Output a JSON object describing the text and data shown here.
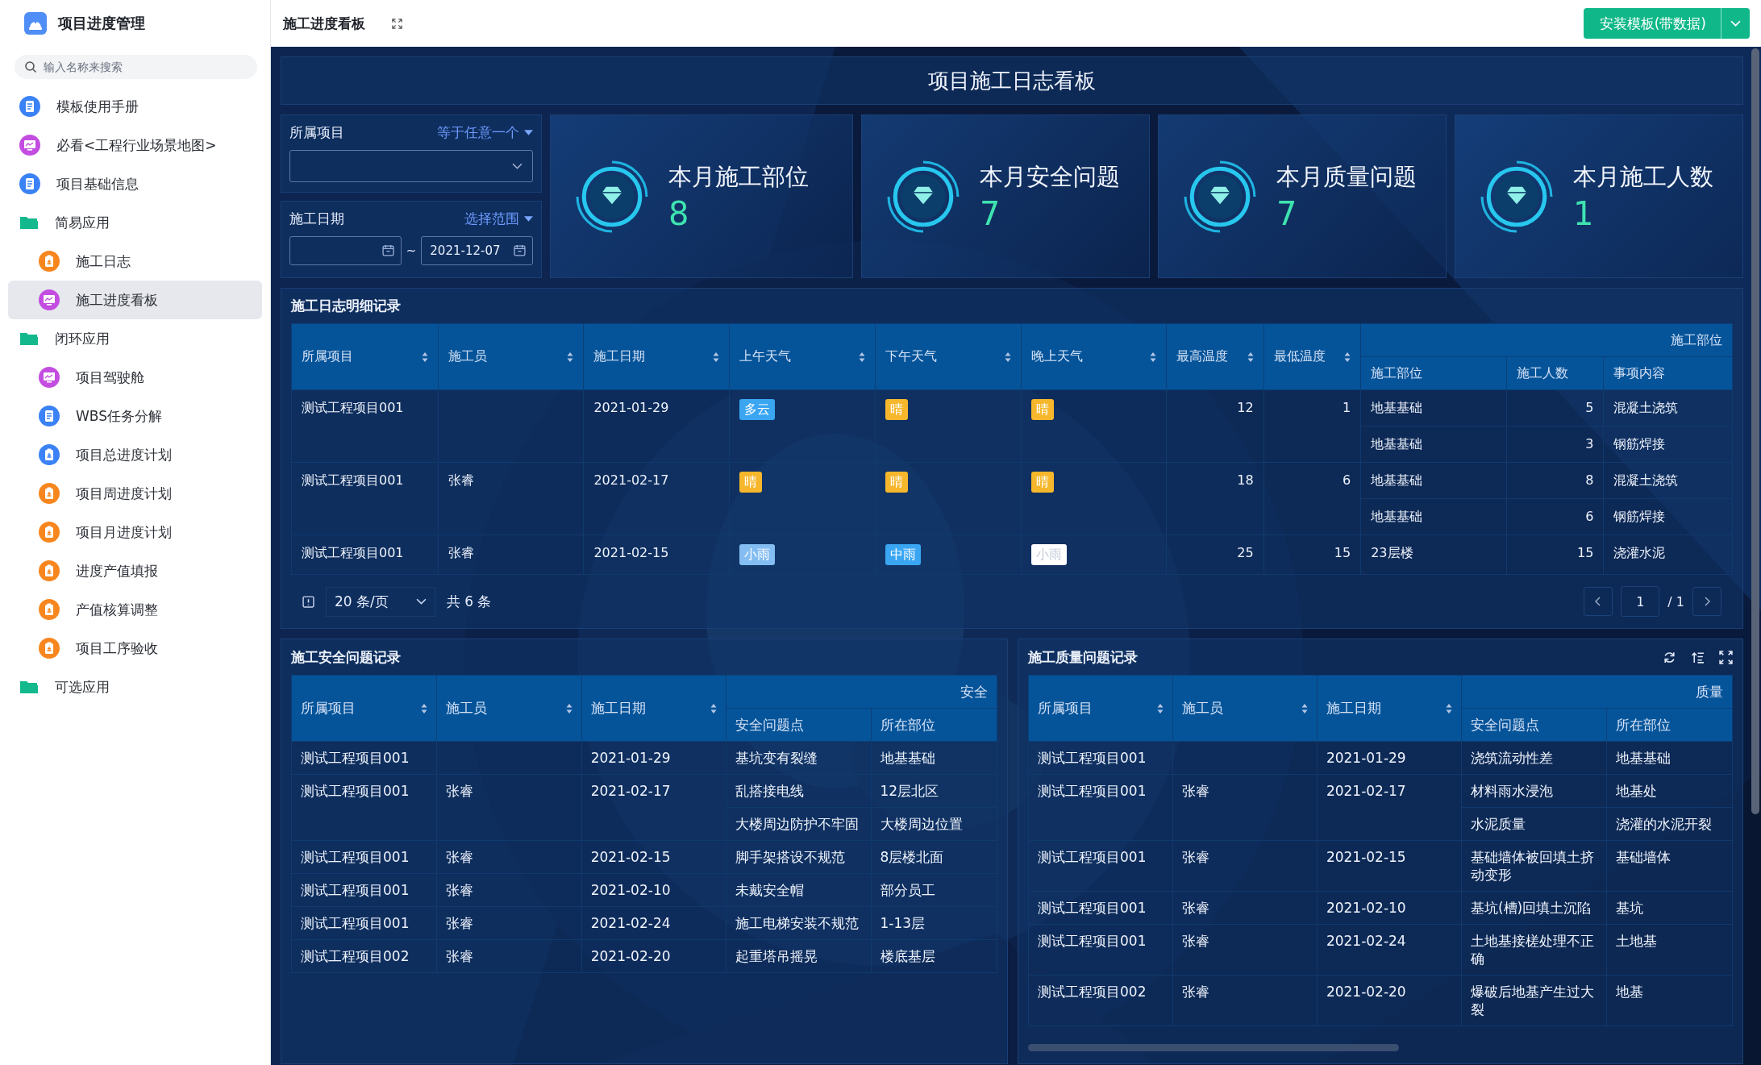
{
  "app": {
    "title": "项目进度管理"
  },
  "sidebar": {
    "search": {
      "placeholder": "输入名称来搜索"
    },
    "items": [
      {
        "label": "模板使用手册",
        "kind": "doc",
        "color": "#3b82f6",
        "selected": false
      },
      {
        "label": "必看<工程行业场景地图>",
        "kind": "screen",
        "color": "#c34de0",
        "selected": false
      },
      {
        "label": "项目基础信息",
        "kind": "doc",
        "color": "#3b82f6",
        "selected": false
      },
      {
        "label": "简易应用",
        "kind": "folder",
        "color": "#13b98c",
        "selected": false,
        "children": [
          {
            "label": "施工日志",
            "kind": "form",
            "color": "#f7861e",
            "selected": false
          },
          {
            "label": "施工进度看板",
            "kind": "screen",
            "color": "#c34de0",
            "selected": true
          }
        ]
      },
      {
        "label": "闭环应用",
        "kind": "folder",
        "color": "#13b98c",
        "selected": false,
        "children": [
          {
            "label": "项目驾驶舱",
            "kind": "screen",
            "color": "#c34de0",
            "selected": false
          },
          {
            "label": "WBS任务分解",
            "kind": "doc",
            "color": "#3b82f6",
            "selected": false
          },
          {
            "label": "项目总进度计划",
            "kind": "form",
            "color": "#3b82f6",
            "selected": false
          },
          {
            "label": "项目周进度计划",
            "kind": "form",
            "color": "#f7861e",
            "selected": false
          },
          {
            "label": "项目月进度计划",
            "kind": "form",
            "color": "#f7861e",
            "selected": false
          },
          {
            "label": "进度产值填报",
            "kind": "form",
            "color": "#f7861e",
            "selected": false
          },
          {
            "label": "产值核算调整",
            "kind": "form",
            "color": "#f7861e",
            "selected": false
          },
          {
            "label": "项目工序验收",
            "kind": "form",
            "color": "#f7861e",
            "selected": false
          }
        ]
      },
      {
        "label": "可选应用",
        "kind": "folder",
        "color": "#13b98c",
        "selected": false
      }
    ]
  },
  "topbar": {
    "title": "施工进度看板",
    "install_button": "安装模板(带数据)"
  },
  "board": {
    "title": "项目施工日志看板",
    "filters": [
      {
        "label": "所属项目",
        "mode": "等于任意一个",
        "kind": "select"
      },
      {
        "label": "施工日期",
        "mode": "选择范围",
        "kind": "daterange",
        "separator": "~",
        "end": "2021-12-07"
      }
    ],
    "stats": [
      {
        "label": "本月施工部位",
        "value": "8"
      },
      {
        "label": "本月安全问题",
        "value": "7"
      },
      {
        "label": "本月质量问题",
        "value": "7"
      },
      {
        "label": "本月施工人数",
        "value": "1"
      }
    ],
    "log_table": {
      "title": "施工日志明细记录",
      "columns": [
        "所属项目",
        "施工员",
        "施工日期",
        "上午天气",
        "下午天气",
        "晚上天气",
        "最高温度",
        "最低温度"
      ],
      "group_header": "施工部位",
      "sub_columns": [
        "施工部位",
        "施工人数",
        "事项内容"
      ],
      "rows": [
        {
          "project": "测试工程项目001",
          "date": "2021-01-29",
          "weather": [
            {
              "text": "多云",
              "color": "#3aa6f2"
            },
            {
              "text": "晴",
              "color": "#f6b72c"
            },
            {
              "text": "晴",
              "color": "#f6b72c"
            }
          ],
          "max": "12",
          "min": "1",
          "parts": [
            {
              "part": "地基基础",
              "count": "5",
              "content": "混凝土浇筑"
            },
            {
              "part": "地基基础",
              "count": "3",
              "content": "钢筋焊接"
            }
          ]
        },
        {
          "project": "测试工程项目001",
          "worker": "张睿",
          "date": "2021-02-17",
          "weather": [
            {
              "text": "晴",
              "color": "#f6b72c"
            },
            {
              "text": "晴",
              "color": "#f6b72c"
            },
            {
              "text": "晴",
              "color": "#f6b72c"
            }
          ],
          "max": "18",
          "min": "6",
          "parts": [
            {
              "part": "地基基础",
              "count": "8",
              "content": "混凝土浇筑"
            },
            {
              "part": "地基基础",
              "count": "6",
              "content": "钢筋焊接"
            }
          ]
        },
        {
          "project": "测试工程项目001",
          "worker": "张睿",
          "date": "2021-02-15",
          "weather": [
            {
              "text": "小雨",
              "color": "#84bdf2"
            },
            {
              "text": "中雨",
              "color": "#3aa6f2"
            },
            {
              "text": "小雨",
              "color": "#ffffff"
            }
          ],
          "max": "25",
          "min": "15",
          "parts": [
            {
              "part": "23层楼",
              "count": "15",
              "content": "浇灌水泥"
            }
          ]
        }
      ],
      "pagination": {
        "page_size": "20 条/页",
        "total": "共 6 条",
        "page": "1",
        "pages": "/ 1"
      }
    },
    "safety_table": {
      "title": "施工安全问题记录",
      "columns": [
        "所属项目",
        "施工员",
        "施工日期"
      ],
      "group_header": "安全",
      "sub_columns": [
        "安全问题点",
        "所在部位"
      ],
      "rows": [
        {
          "project": "测试工程项目001",
          "date": "2021-01-29",
          "issues": [
            {
              "point": "基坑变有裂缝",
              "location": "地基基础"
            }
          ]
        },
        {
          "project": "测试工程项目001",
          "worker": "张睿",
          "date": "2021-02-17",
          "issues": [
            {
              "point": "乱搭接电线",
              "location": "12层北区"
            },
            {
              "point": "大楼周边防护不牢固",
              "location": "大楼周边位置"
            }
          ]
        },
        {
          "project": "测试工程项目001",
          "worker": "张睿",
          "date": "2021-02-15",
          "issues": [
            {
              "point": "脚手架搭设不规范",
              "location": "8层楼北面"
            }
          ]
        },
        {
          "project": "测试工程项目001",
          "worker": "张睿",
          "date": "2021-02-10",
          "issues": [
            {
              "point": "未戴安全帽",
              "location": "部分员工"
            }
          ]
        },
        {
          "project": "测试工程项目001",
          "worker": "张睿",
          "date": "2021-02-24",
          "issues": [
            {
              "point": "施工电梯安装不规范",
              "location": "1-13层"
            }
          ]
        },
        {
          "project": "测试工程项目002",
          "worker": "张睿",
          "date": "2021-02-20",
          "issues": [
            {
              "point": "起重塔吊摇晃",
              "location": "楼底基层"
            }
          ]
        }
      ]
    },
    "quality_table": {
      "title": "施工质量问题记录",
      "columns": [
        "所属项目",
        "施工员",
        "施工日期"
      ],
      "group_header": "质量",
      "sub_columns": [
        "安全问题点",
        "所在部位"
      ],
      "rows": [
        {
          "project": "测试工程项目001",
          "date": "2021-01-29",
          "issues": [
            {
              "point": "浇筑流动性差",
              "location": "地基基础"
            }
          ]
        },
        {
          "project": "测试工程项目001",
          "worker": "张睿",
          "date": "2021-02-17",
          "issues": [
            {
              "point": "材料雨水浸泡",
              "location": "地基处"
            },
            {
              "point": "水泥质量",
              "location": "浇灌的水泥开裂"
            }
          ]
        },
        {
          "project": "测试工程项目001",
          "worker": "张睿",
          "date": "2021-02-15",
          "issues": [
            {
              "point": "基础墙体被回填土挤动变形",
              "location": "基础墙体"
            }
          ]
        },
        {
          "project": "测试工程项目001",
          "worker": "张睿",
          "date": "2021-02-10",
          "issues": [
            {
              "point": "基坑(槽)回填土沉陷",
              "location": "基坑"
            }
          ]
        },
        {
          "project": "测试工程项目001",
          "worker": "张睿",
          "date": "2021-02-24",
          "issues": [
            {
              "point": "土地基接槎处理不正确",
              "location": "土地基"
            }
          ]
        },
        {
          "project": "测试工程项目002",
          "worker": "张睿",
          "date": "2021-02-20",
          "issues": [
            {
              "point": "爆破后地基产生过大裂",
              "location": "地基"
            }
          ]
        }
      ]
    }
  }
}
